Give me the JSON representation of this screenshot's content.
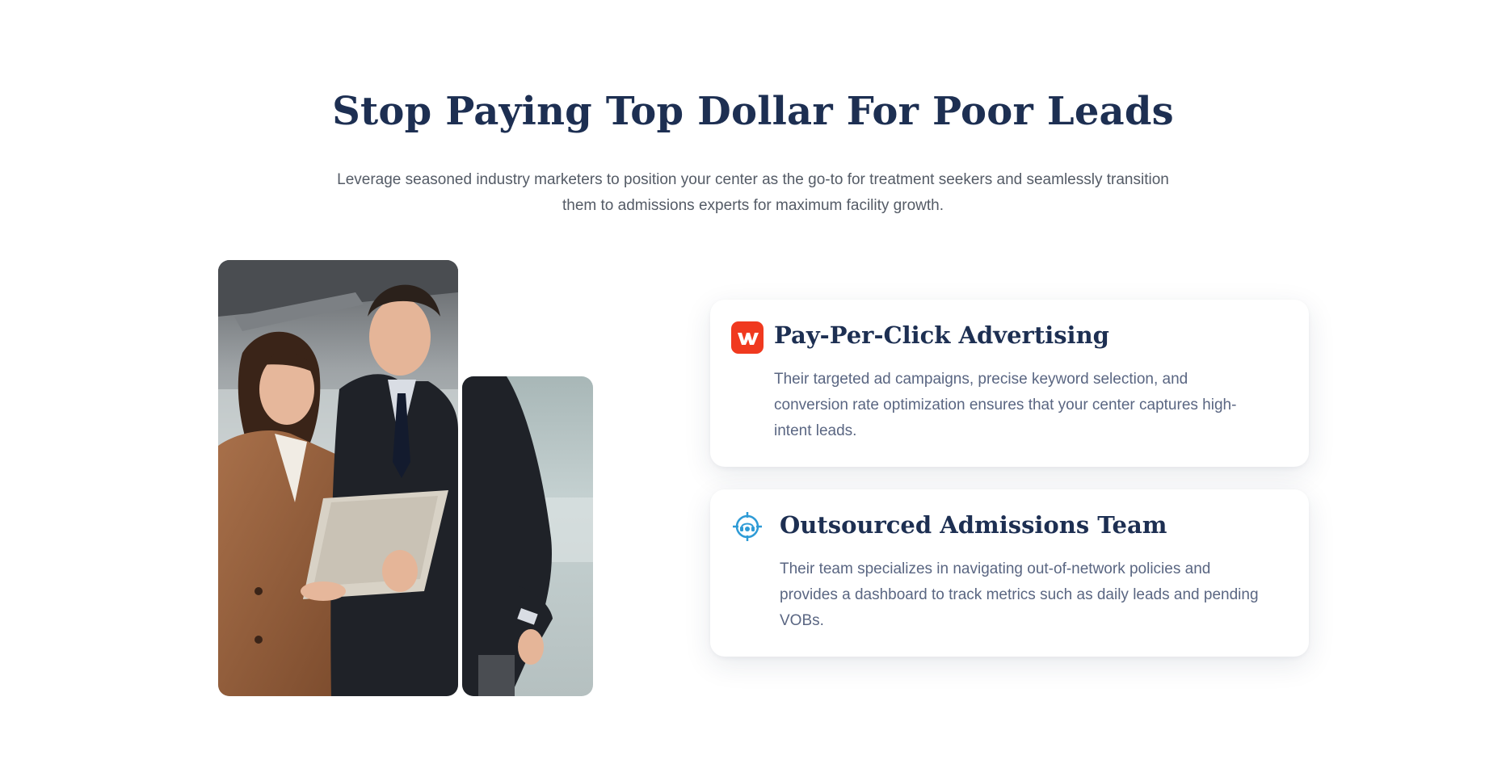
{
  "hero": {
    "title": "Stop Paying Top Dollar For Poor Leads",
    "subtitle": "Leverage seasoned industry marketers to position your center as the go-to for treatment seekers and seamlessly transition them to admissions experts for maximum facility growth."
  },
  "images": {
    "main_photo": "business-people-with-tablet-photo",
    "side_photo": "businessman-side-photo"
  },
  "services": [
    {
      "icon": "ppc-logo-icon",
      "icon_color": "#f0391f",
      "title": "Pay-Per-Click Advertising",
      "description": "Their targeted ad campaigns, precise keyword selection, and conversion rate optimization ensures that your center captures high-intent leads."
    },
    {
      "icon": "target-headset-icon",
      "icon_color": "#2e9bd6",
      "title": "Outsourced Admissions Team",
      "description": "Their team specializes in navigating out-of-network policies and provides a dashboard to track metrics such as daily leads and pending VOBs."
    }
  ],
  "colors": {
    "heading": "#1d2f52",
    "body_text": "#545b66",
    "card_text": "#5a6682",
    "background": "#ffffff"
  }
}
